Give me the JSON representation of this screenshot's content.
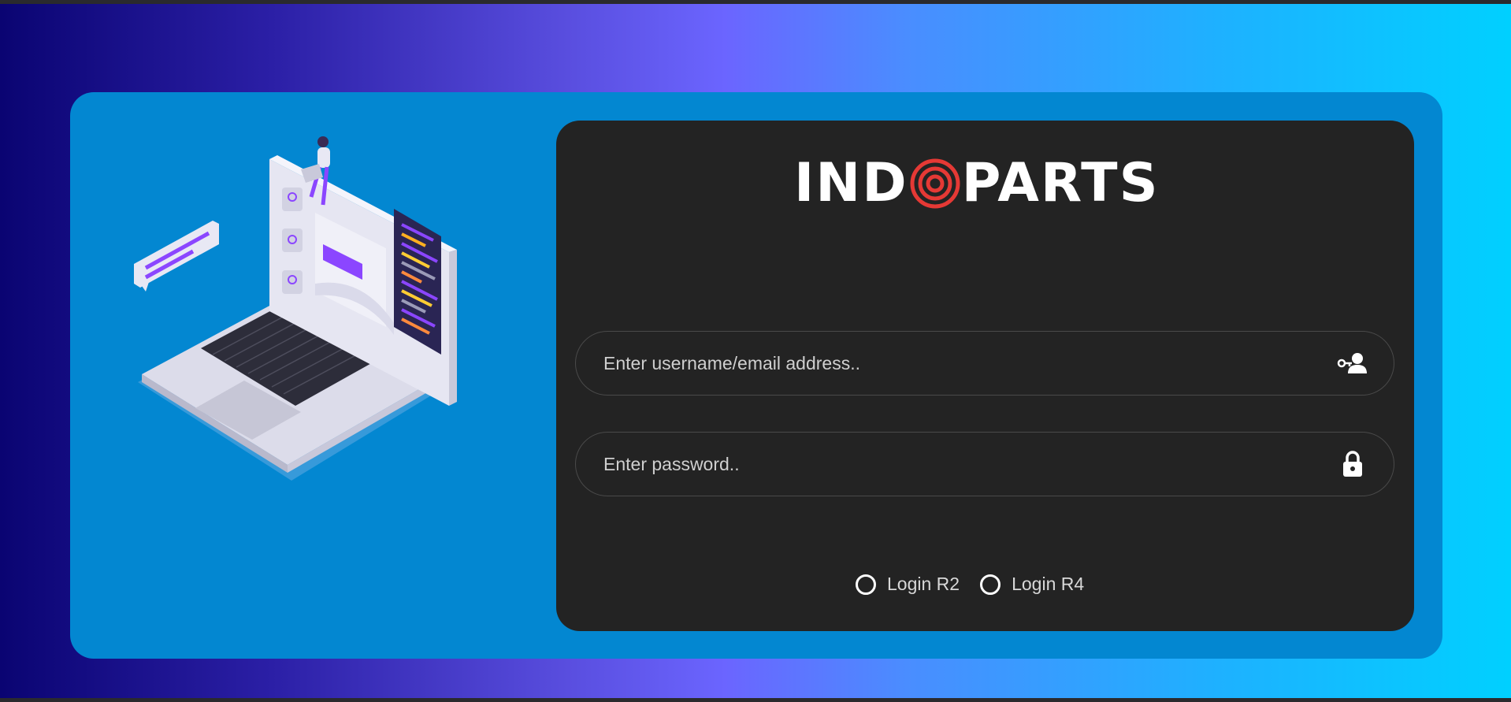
{
  "brand": {
    "logo_left": "IND",
    "logo_right": "PARTS",
    "accent_color": "#e53935"
  },
  "login": {
    "username_placeholder": "Enter username/email address..",
    "password_placeholder": "Enter password..",
    "username_icon": "user-key-icon",
    "password_icon": "lock-icon",
    "options": [
      {
        "label": "Login R2",
        "checked": false
      },
      {
        "label": "Login R4",
        "checked": false
      }
    ]
  },
  "colors": {
    "outer_card": "#0387d1",
    "panel": "#232323",
    "illustration_accent": "#8b46ff"
  }
}
